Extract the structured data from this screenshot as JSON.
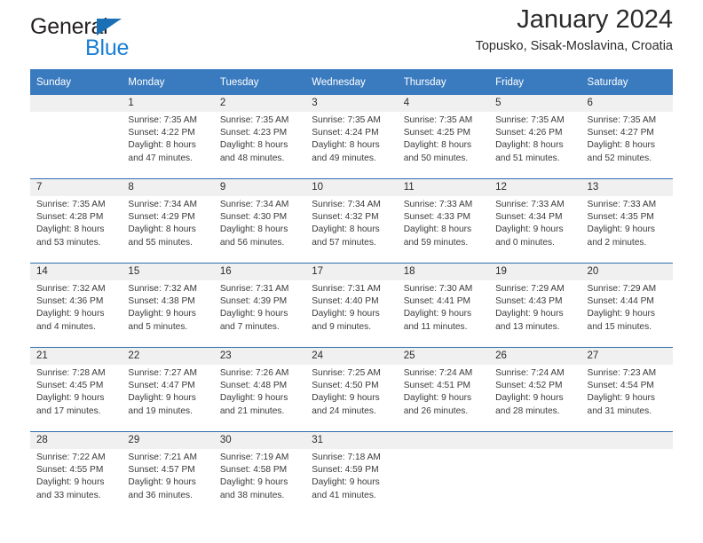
{
  "brand": {
    "name_part1": "General",
    "name_part2": "Blue",
    "logo_icon": "triangle-flag-icon"
  },
  "header": {
    "title": "January 2024",
    "subtitle": "Topusko, Sisak-Moslavina, Croatia"
  },
  "colors": {
    "header_blue": "#3a7bbf",
    "separator_blue": "#2f6daf",
    "daynum_band": "#f0f0f0",
    "brand_blue": "#1a7fd4",
    "text": "#2b2b2b"
  },
  "calendar": {
    "weekday_headers": [
      "Sunday",
      "Monday",
      "Tuesday",
      "Wednesday",
      "Thursday",
      "Friday",
      "Saturday"
    ],
    "weeks": [
      {
        "days": [
          {
            "num": "",
            "line1": "",
            "line2": "",
            "line3": "",
            "line4": ""
          },
          {
            "num": "1",
            "line1": "Sunrise: 7:35 AM",
            "line2": "Sunset: 4:22 PM",
            "line3": "Daylight: 8 hours",
            "line4": "and 47 minutes."
          },
          {
            "num": "2",
            "line1": "Sunrise: 7:35 AM",
            "line2": "Sunset: 4:23 PM",
            "line3": "Daylight: 8 hours",
            "line4": "and 48 minutes."
          },
          {
            "num": "3",
            "line1": "Sunrise: 7:35 AM",
            "line2": "Sunset: 4:24 PM",
            "line3": "Daylight: 8 hours",
            "line4": "and 49 minutes."
          },
          {
            "num": "4",
            "line1": "Sunrise: 7:35 AM",
            "line2": "Sunset: 4:25 PM",
            "line3": "Daylight: 8 hours",
            "line4": "and 50 minutes."
          },
          {
            "num": "5",
            "line1": "Sunrise: 7:35 AM",
            "line2": "Sunset: 4:26 PM",
            "line3": "Daylight: 8 hours",
            "line4": "and 51 minutes."
          },
          {
            "num": "6",
            "line1": "Sunrise: 7:35 AM",
            "line2": "Sunset: 4:27 PM",
            "line3": "Daylight: 8 hours",
            "line4": "and 52 minutes."
          }
        ]
      },
      {
        "days": [
          {
            "num": "7",
            "line1": "Sunrise: 7:35 AM",
            "line2": "Sunset: 4:28 PM",
            "line3": "Daylight: 8 hours",
            "line4": "and 53 minutes."
          },
          {
            "num": "8",
            "line1": "Sunrise: 7:34 AM",
            "line2": "Sunset: 4:29 PM",
            "line3": "Daylight: 8 hours",
            "line4": "and 55 minutes."
          },
          {
            "num": "9",
            "line1": "Sunrise: 7:34 AM",
            "line2": "Sunset: 4:30 PM",
            "line3": "Daylight: 8 hours",
            "line4": "and 56 minutes."
          },
          {
            "num": "10",
            "line1": "Sunrise: 7:34 AM",
            "line2": "Sunset: 4:32 PM",
            "line3": "Daylight: 8 hours",
            "line4": "and 57 minutes."
          },
          {
            "num": "11",
            "line1": "Sunrise: 7:33 AM",
            "line2": "Sunset: 4:33 PM",
            "line3": "Daylight: 8 hours",
            "line4": "and 59 minutes."
          },
          {
            "num": "12",
            "line1": "Sunrise: 7:33 AM",
            "line2": "Sunset: 4:34 PM",
            "line3": "Daylight: 9 hours",
            "line4": "and 0 minutes."
          },
          {
            "num": "13",
            "line1": "Sunrise: 7:33 AM",
            "line2": "Sunset: 4:35 PM",
            "line3": "Daylight: 9 hours",
            "line4": "and 2 minutes."
          }
        ]
      },
      {
        "days": [
          {
            "num": "14",
            "line1": "Sunrise: 7:32 AM",
            "line2": "Sunset: 4:36 PM",
            "line3": "Daylight: 9 hours",
            "line4": "and 4 minutes."
          },
          {
            "num": "15",
            "line1": "Sunrise: 7:32 AM",
            "line2": "Sunset: 4:38 PM",
            "line3": "Daylight: 9 hours",
            "line4": "and 5 minutes."
          },
          {
            "num": "16",
            "line1": "Sunrise: 7:31 AM",
            "line2": "Sunset: 4:39 PM",
            "line3": "Daylight: 9 hours",
            "line4": "and 7 minutes."
          },
          {
            "num": "17",
            "line1": "Sunrise: 7:31 AM",
            "line2": "Sunset: 4:40 PM",
            "line3": "Daylight: 9 hours",
            "line4": "and 9 minutes."
          },
          {
            "num": "18",
            "line1": "Sunrise: 7:30 AM",
            "line2": "Sunset: 4:41 PM",
            "line3": "Daylight: 9 hours",
            "line4": "and 11 minutes."
          },
          {
            "num": "19",
            "line1": "Sunrise: 7:29 AM",
            "line2": "Sunset: 4:43 PM",
            "line3": "Daylight: 9 hours",
            "line4": "and 13 minutes."
          },
          {
            "num": "20",
            "line1": "Sunrise: 7:29 AM",
            "line2": "Sunset: 4:44 PM",
            "line3": "Daylight: 9 hours",
            "line4": "and 15 minutes."
          }
        ]
      },
      {
        "days": [
          {
            "num": "21",
            "line1": "Sunrise: 7:28 AM",
            "line2": "Sunset: 4:45 PM",
            "line3": "Daylight: 9 hours",
            "line4": "and 17 minutes."
          },
          {
            "num": "22",
            "line1": "Sunrise: 7:27 AM",
            "line2": "Sunset: 4:47 PM",
            "line3": "Daylight: 9 hours",
            "line4": "and 19 minutes."
          },
          {
            "num": "23",
            "line1": "Sunrise: 7:26 AM",
            "line2": "Sunset: 4:48 PM",
            "line3": "Daylight: 9 hours",
            "line4": "and 21 minutes."
          },
          {
            "num": "24",
            "line1": "Sunrise: 7:25 AM",
            "line2": "Sunset: 4:50 PM",
            "line3": "Daylight: 9 hours",
            "line4": "and 24 minutes."
          },
          {
            "num": "25",
            "line1": "Sunrise: 7:24 AM",
            "line2": "Sunset: 4:51 PM",
            "line3": "Daylight: 9 hours",
            "line4": "and 26 minutes."
          },
          {
            "num": "26",
            "line1": "Sunrise: 7:24 AM",
            "line2": "Sunset: 4:52 PM",
            "line3": "Daylight: 9 hours",
            "line4": "and 28 minutes."
          },
          {
            "num": "27",
            "line1": "Sunrise: 7:23 AM",
            "line2": "Sunset: 4:54 PM",
            "line3": "Daylight: 9 hours",
            "line4": "and 31 minutes."
          }
        ]
      },
      {
        "days": [
          {
            "num": "28",
            "line1": "Sunrise: 7:22 AM",
            "line2": "Sunset: 4:55 PM",
            "line3": "Daylight: 9 hours",
            "line4": "and 33 minutes."
          },
          {
            "num": "29",
            "line1": "Sunrise: 7:21 AM",
            "line2": "Sunset: 4:57 PM",
            "line3": "Daylight: 9 hours",
            "line4": "and 36 minutes."
          },
          {
            "num": "30",
            "line1": "Sunrise: 7:19 AM",
            "line2": "Sunset: 4:58 PM",
            "line3": "Daylight: 9 hours",
            "line4": "and 38 minutes."
          },
          {
            "num": "31",
            "line1": "Sunrise: 7:18 AM",
            "line2": "Sunset: 4:59 PM",
            "line3": "Daylight: 9 hours",
            "line4": "and 41 minutes."
          },
          {
            "num": "",
            "line1": "",
            "line2": "",
            "line3": "",
            "line4": ""
          },
          {
            "num": "",
            "line1": "",
            "line2": "",
            "line3": "",
            "line4": ""
          },
          {
            "num": "",
            "line1": "",
            "line2": "",
            "line3": "",
            "line4": ""
          }
        ]
      }
    ]
  }
}
